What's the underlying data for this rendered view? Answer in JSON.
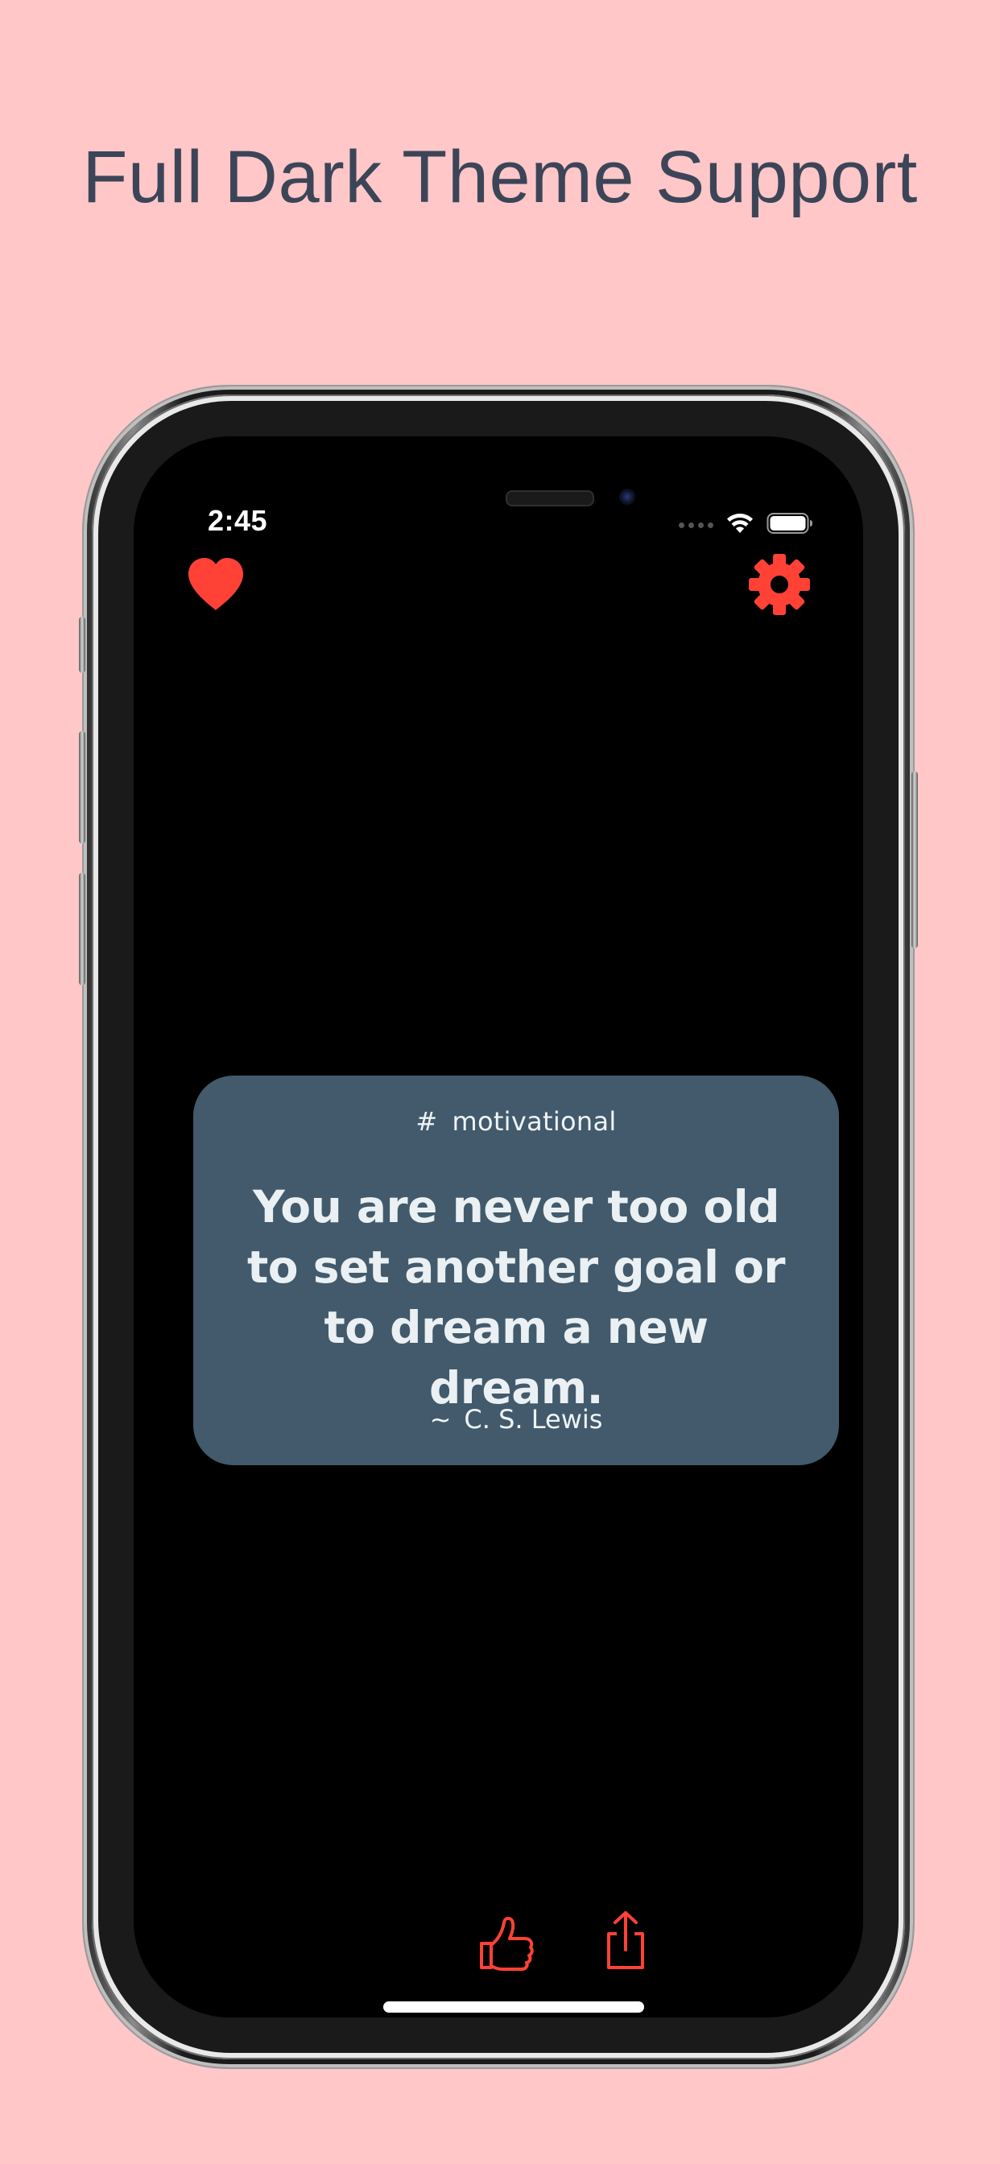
{
  "headline": "Full Dark Theme Support",
  "status_bar": {
    "time": "2:45"
  },
  "top_bar": {
    "favorites_icon": "heart-icon",
    "settings_icon": "gear-icon"
  },
  "quote_card": {
    "hash": "#",
    "tag": "motivational",
    "quote": "You are never too old to set another goal or to dream a new dream.",
    "tilde": "~",
    "author": "C. S. Lewis"
  },
  "bottom_bar": {
    "like_icon": "thumbs-up-icon",
    "share_icon": "share-icon"
  },
  "colors": {
    "background": "#ffc7c8",
    "headline": "#3c4558",
    "accent": "#ff4136",
    "card": "#425a6b",
    "screen": "#000000"
  }
}
